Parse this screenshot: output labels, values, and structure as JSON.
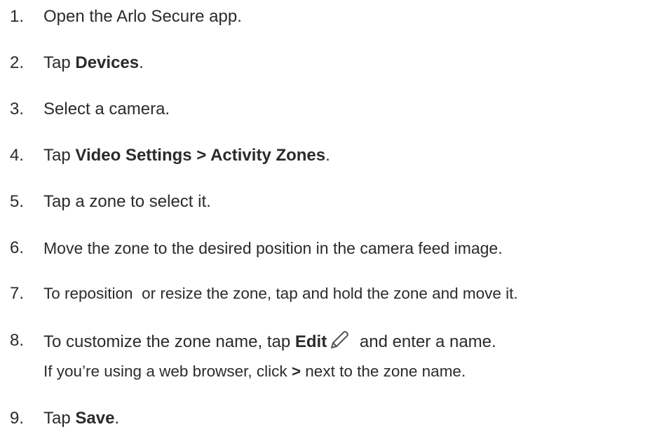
{
  "steps": [
    {
      "number": "1.",
      "text": "Open the Arlo Secure app."
    },
    {
      "number": "2.",
      "pre": "Tap ",
      "bold": "Devices",
      "post": "."
    },
    {
      "number": "3.",
      "text": "Select a camera."
    },
    {
      "number": "4.",
      "pre": "Tap ",
      "bold": "Video Settings > Activity Zones",
      "post": "."
    },
    {
      "number": "5.",
      "text": "Tap a zone to select it."
    },
    {
      "number": "6.",
      "text": "Move the zone to the desired position in the camera feed image."
    },
    {
      "number": "7.",
      "text": "To reposition  or resize the zone, tap and hold the zone and move it."
    },
    {
      "number": "8.",
      "pre": "To customize the zone name, tap ",
      "bold": "Edit",
      "icon": "pencil-icon",
      "post": " and enter a name.",
      "line2_pre": "If you’re using a web browser, click ",
      "line2_bold": ">",
      "line2_post": " next to the zone name."
    },
    {
      "number": "9.",
      "pre": "Tap ",
      "bold": "Save",
      "post": "."
    }
  ]
}
